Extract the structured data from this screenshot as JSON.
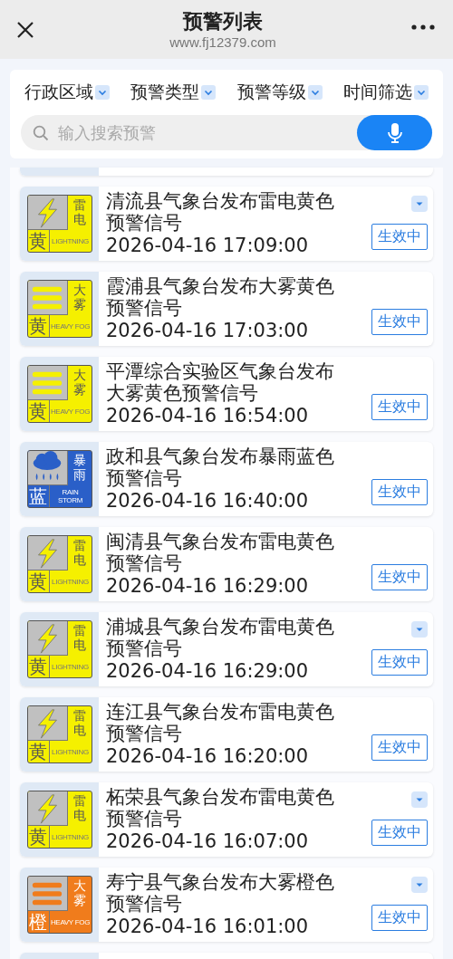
{
  "header": {
    "title": "预警列表",
    "url": "www.fj12379.com"
  },
  "filters": [
    "行政区域",
    "预警类型",
    "预警等级",
    "时间筛选"
  ],
  "search": {
    "placeholder": "输入搜索预警"
  },
  "warnings": [
    {
      "kind": "lightning",
      "color": "#f5f000",
      "level_char": "黄",
      "type_chars": "雷电",
      "english": "LIGHTNING",
      "title": "清流县气象台发布雷电黄色预警信号",
      "time": "2026-04-16 17:09:00",
      "status": "生效中",
      "has_menu": true
    },
    {
      "kind": "fog",
      "color": "#f5f000",
      "level_char": "黄",
      "type_chars": "大雾",
      "english": "HEAVY FOG",
      "title": "霞浦县气象台发布大雾黄色预警信号",
      "time": "2026-04-16 17:03:00",
      "status": "生效中",
      "has_menu": false
    },
    {
      "kind": "fog",
      "color": "#f5f000",
      "level_char": "黄",
      "type_chars": "大雾",
      "english": "HEAVY FOG",
      "title": "平潭综合实验区气象台发布大雾黄色预警信号",
      "time": "2026-04-16 16:54:00",
      "status": "生效中",
      "has_menu": false
    },
    {
      "kind": "rain",
      "color": "#2a5fc8",
      "level_char": "蓝",
      "type_chars": "暴雨",
      "english": "RAIN STORM",
      "title": "政和县气象台发布暴雨蓝色预警信号",
      "time": "2026-04-16 16:40:00",
      "status": "生效中",
      "has_menu": false
    },
    {
      "kind": "lightning",
      "color": "#f5f000",
      "level_char": "黄",
      "type_chars": "雷电",
      "english": "LIGHTNING",
      "title": "闽清县气象台发布雷电黄色预警信号",
      "time": "2026-04-16 16:29:00",
      "status": "生效中",
      "has_menu": false
    },
    {
      "kind": "lightning",
      "color": "#f5f000",
      "level_char": "黄",
      "type_chars": "雷电",
      "english": "LIGHTNING",
      "title": "浦城县气象台发布雷电黄色预警信号",
      "time": "2026-04-16 16:29:00",
      "status": "生效中",
      "has_menu": true
    },
    {
      "kind": "lightning",
      "color": "#f5f000",
      "level_char": "黄",
      "type_chars": "雷电",
      "english": "LIGHTNING",
      "title": "连江县气象台发布雷电黄色预警信号",
      "time": "2026-04-16 16:20:00",
      "status": "生效中",
      "has_menu": false
    },
    {
      "kind": "lightning",
      "color": "#f5f000",
      "level_char": "黄",
      "type_chars": "雷电",
      "english": "LIGHTNING",
      "title": "柘荣县气象台发布雷电黄色预警信号",
      "time": "2026-04-16 16:07:00",
      "status": "生效中",
      "has_menu": true
    },
    {
      "kind": "fog",
      "color": "#f07c1c",
      "level_char": "橙",
      "type_chars": "大雾",
      "english": "HEAVY FOG",
      "title": "寿宁县气象台发布大雾橙色预警信号",
      "time": "2026-04-16 16:01:00",
      "status": "生效中",
      "has_menu": true
    }
  ]
}
